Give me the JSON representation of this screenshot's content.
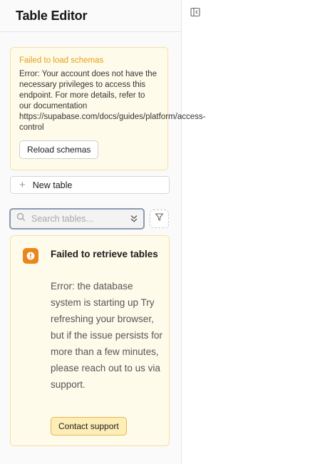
{
  "header": {
    "title": "Table Editor"
  },
  "schema_alert": {
    "title": "Failed to load schemas",
    "body": "Error: Your account does not have the necessary privileges to access this endpoint. For more details, refer to our documentation https://supabase.com/docs/guides/platform/access-control",
    "reload_label": "Reload schemas"
  },
  "new_table": {
    "label": "New table"
  },
  "search": {
    "placeholder": "Search tables...",
    "value": ""
  },
  "tables_alert": {
    "title": "Failed to retrieve tables",
    "body": "Error: the database system is starting up Try refreshing your browser, but if the issue persists for more than a few minutes, please reach out to us via support.",
    "contact_label": "Contact support"
  },
  "icons": {
    "toggle": "sidebar-collapse-icon",
    "search": "search-icon",
    "chevrons": "chevrons-up-down-icon",
    "filter": "filter-icon",
    "warning": "alert-icon",
    "plus": "plus-icon"
  },
  "colors": {
    "warning_bg": "#fffbeb",
    "warning_border": "#f7dfa3",
    "warning_title": "#e3a018",
    "warning_icon": "#e8881c",
    "contact_button": "#fdeeb7"
  }
}
